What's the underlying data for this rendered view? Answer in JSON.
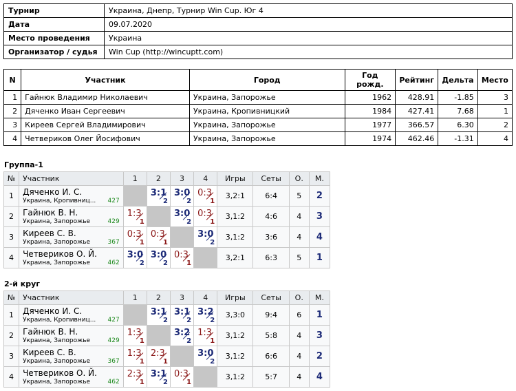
{
  "info": [
    {
      "label": "Турнир",
      "value": "Украина, Днепр, Турнир Win Cup. Юг 4"
    },
    {
      "label": "Дата",
      "value": "09.07.2020"
    },
    {
      "label": "Место проведения",
      "value": "Украина"
    },
    {
      "label": "Организатор / судья",
      "value": "Win Cup (http://wincuptt.com)"
    }
  ],
  "participants": {
    "headers": [
      "N",
      "Участник",
      "Город",
      "Год рожд.",
      "Рейтинг",
      "Дельта",
      "Место"
    ],
    "rows": [
      [
        "1",
        "Гайнюк Владимир Николаевич",
        "Украина, Запорожье",
        "1962",
        "428.91",
        "-1.85",
        "3"
      ],
      [
        "2",
        "Дяченко Иван Сергеевич",
        "Украина, Кропивницкий",
        "1984",
        "427.41",
        "7.68",
        "1"
      ],
      [
        "3",
        "Киреев Сергей Владимирович",
        "Украина, Запорожье",
        "1977",
        "366.57",
        "6.30",
        "2"
      ],
      [
        "4",
        "Четвериков Олег Йосифович",
        "Украина, Запорожье",
        "1974",
        "462.46",
        "-1.31",
        "4"
      ]
    ]
  },
  "groups": [
    {
      "title": "Группа-1",
      "headers": [
        "№",
        "Участник",
        "1",
        "2",
        "3",
        "4",
        "Игры",
        "Сеты",
        "О.",
        "М."
      ],
      "rows": [
        {
          "no": "1",
          "name": "Дяченко И. С.",
          "city": "Украина, Кропивниц...",
          "rating": "427",
          "cells": [
            null,
            {
              "s": "3:1",
              "p": "2",
              "w": true
            },
            {
              "s": "3:0",
              "p": "2",
              "w": true
            },
            {
              "s": "0:3",
              "p": "1",
              "w": false
            }
          ],
          "games": "3,2:1",
          "sets": "6:4",
          "points": "5",
          "place": "2"
        },
        {
          "no": "2",
          "name": "Гайнюк В. Н.",
          "city": "Украина, Запорожье",
          "rating": "429",
          "cells": [
            {
              "s": "1:3",
              "p": "1",
              "w": false
            },
            null,
            {
              "s": "3:0",
              "p": "2",
              "w": true
            },
            {
              "s": "0:3",
              "p": "1",
              "w": false
            }
          ],
          "games": "3,1:2",
          "sets": "4:6",
          "points": "4",
          "place": "3"
        },
        {
          "no": "3",
          "name": "Киреев С. В.",
          "city": "Украина, Запорожье",
          "rating": "367",
          "cells": [
            {
              "s": "0:3",
              "p": "1",
              "w": false
            },
            {
              "s": "0:3",
              "p": "1",
              "w": false
            },
            null,
            {
              "s": "3:0",
              "p": "2",
              "w": true
            }
          ],
          "games": "3,1:2",
          "sets": "3:6",
          "points": "4",
          "place": "4"
        },
        {
          "no": "4",
          "name": "Четвериков О. Й.",
          "city": "Украина, Запорожье",
          "rating": "462",
          "cells": [
            {
              "s": "3:0",
              "p": "2",
              "w": true
            },
            {
              "s": "3:0",
              "p": "2",
              "w": true
            },
            {
              "s": "0:3",
              "p": "1",
              "w": false
            },
            null
          ],
          "games": "3,2:1",
          "sets": "6:3",
          "points": "5",
          "place": "1"
        }
      ]
    },
    {
      "title": "2-й круг",
      "headers": [
        "№",
        "Участник",
        "1",
        "2",
        "3",
        "4",
        "Игры",
        "Сеты",
        "О.",
        "М."
      ],
      "rows": [
        {
          "no": "1",
          "name": "Дяченко И. С.",
          "city": "Украина, Кропивниц...",
          "rating": "427",
          "cells": [
            null,
            {
              "s": "3:1",
              "p": "2",
              "w": true
            },
            {
              "s": "3:1",
              "p": "2",
              "w": true
            },
            {
              "s": "3:2",
              "p": "2",
              "w": true
            }
          ],
          "games": "3,3:0",
          "sets": "9:4",
          "points": "6",
          "place": "1"
        },
        {
          "no": "2",
          "name": "Гайнюк В. Н.",
          "city": "Украина, Запорожье",
          "rating": "429",
          "cells": [
            {
              "s": "1:3",
              "p": "1",
              "w": false
            },
            null,
            {
              "s": "3:2",
              "p": "2",
              "w": true
            },
            {
              "s": "1:3",
              "p": "1",
              "w": false
            }
          ],
          "games": "3,1:2",
          "sets": "5:8",
          "points": "4",
          "place": "3"
        },
        {
          "no": "3",
          "name": "Киреев С. В.",
          "city": "Украина, Запорожье",
          "rating": "367",
          "cells": [
            {
              "s": "1:3",
              "p": "1",
              "w": false
            },
            {
              "s": "2:3",
              "p": "1",
              "w": false
            },
            null,
            {
              "s": "3:0",
              "p": "2",
              "w": true
            }
          ],
          "games": "3,1:2",
          "sets": "6:6",
          "points": "4",
          "place": "2"
        },
        {
          "no": "4",
          "name": "Четвериков О. Й.",
          "city": "Украина, Запорожье",
          "rating": "462",
          "cells": [
            {
              "s": "2:3",
              "p": "1",
              "w": false
            },
            {
              "s": "3:1",
              "p": "2",
              "w": true
            },
            {
              "s": "0:3",
              "p": "1",
              "w": false
            },
            null
          ],
          "games": "3,1:2",
          "sets": "5:7",
          "points": "4",
          "place": "4"
        }
      ]
    }
  ],
  "colors": {
    "win": "#1c2a77",
    "loss": "#8a1616",
    "rating": "#1f8a1f",
    "diagonal": "#c6c6c6",
    "header_bg": "#e9ecef"
  }
}
